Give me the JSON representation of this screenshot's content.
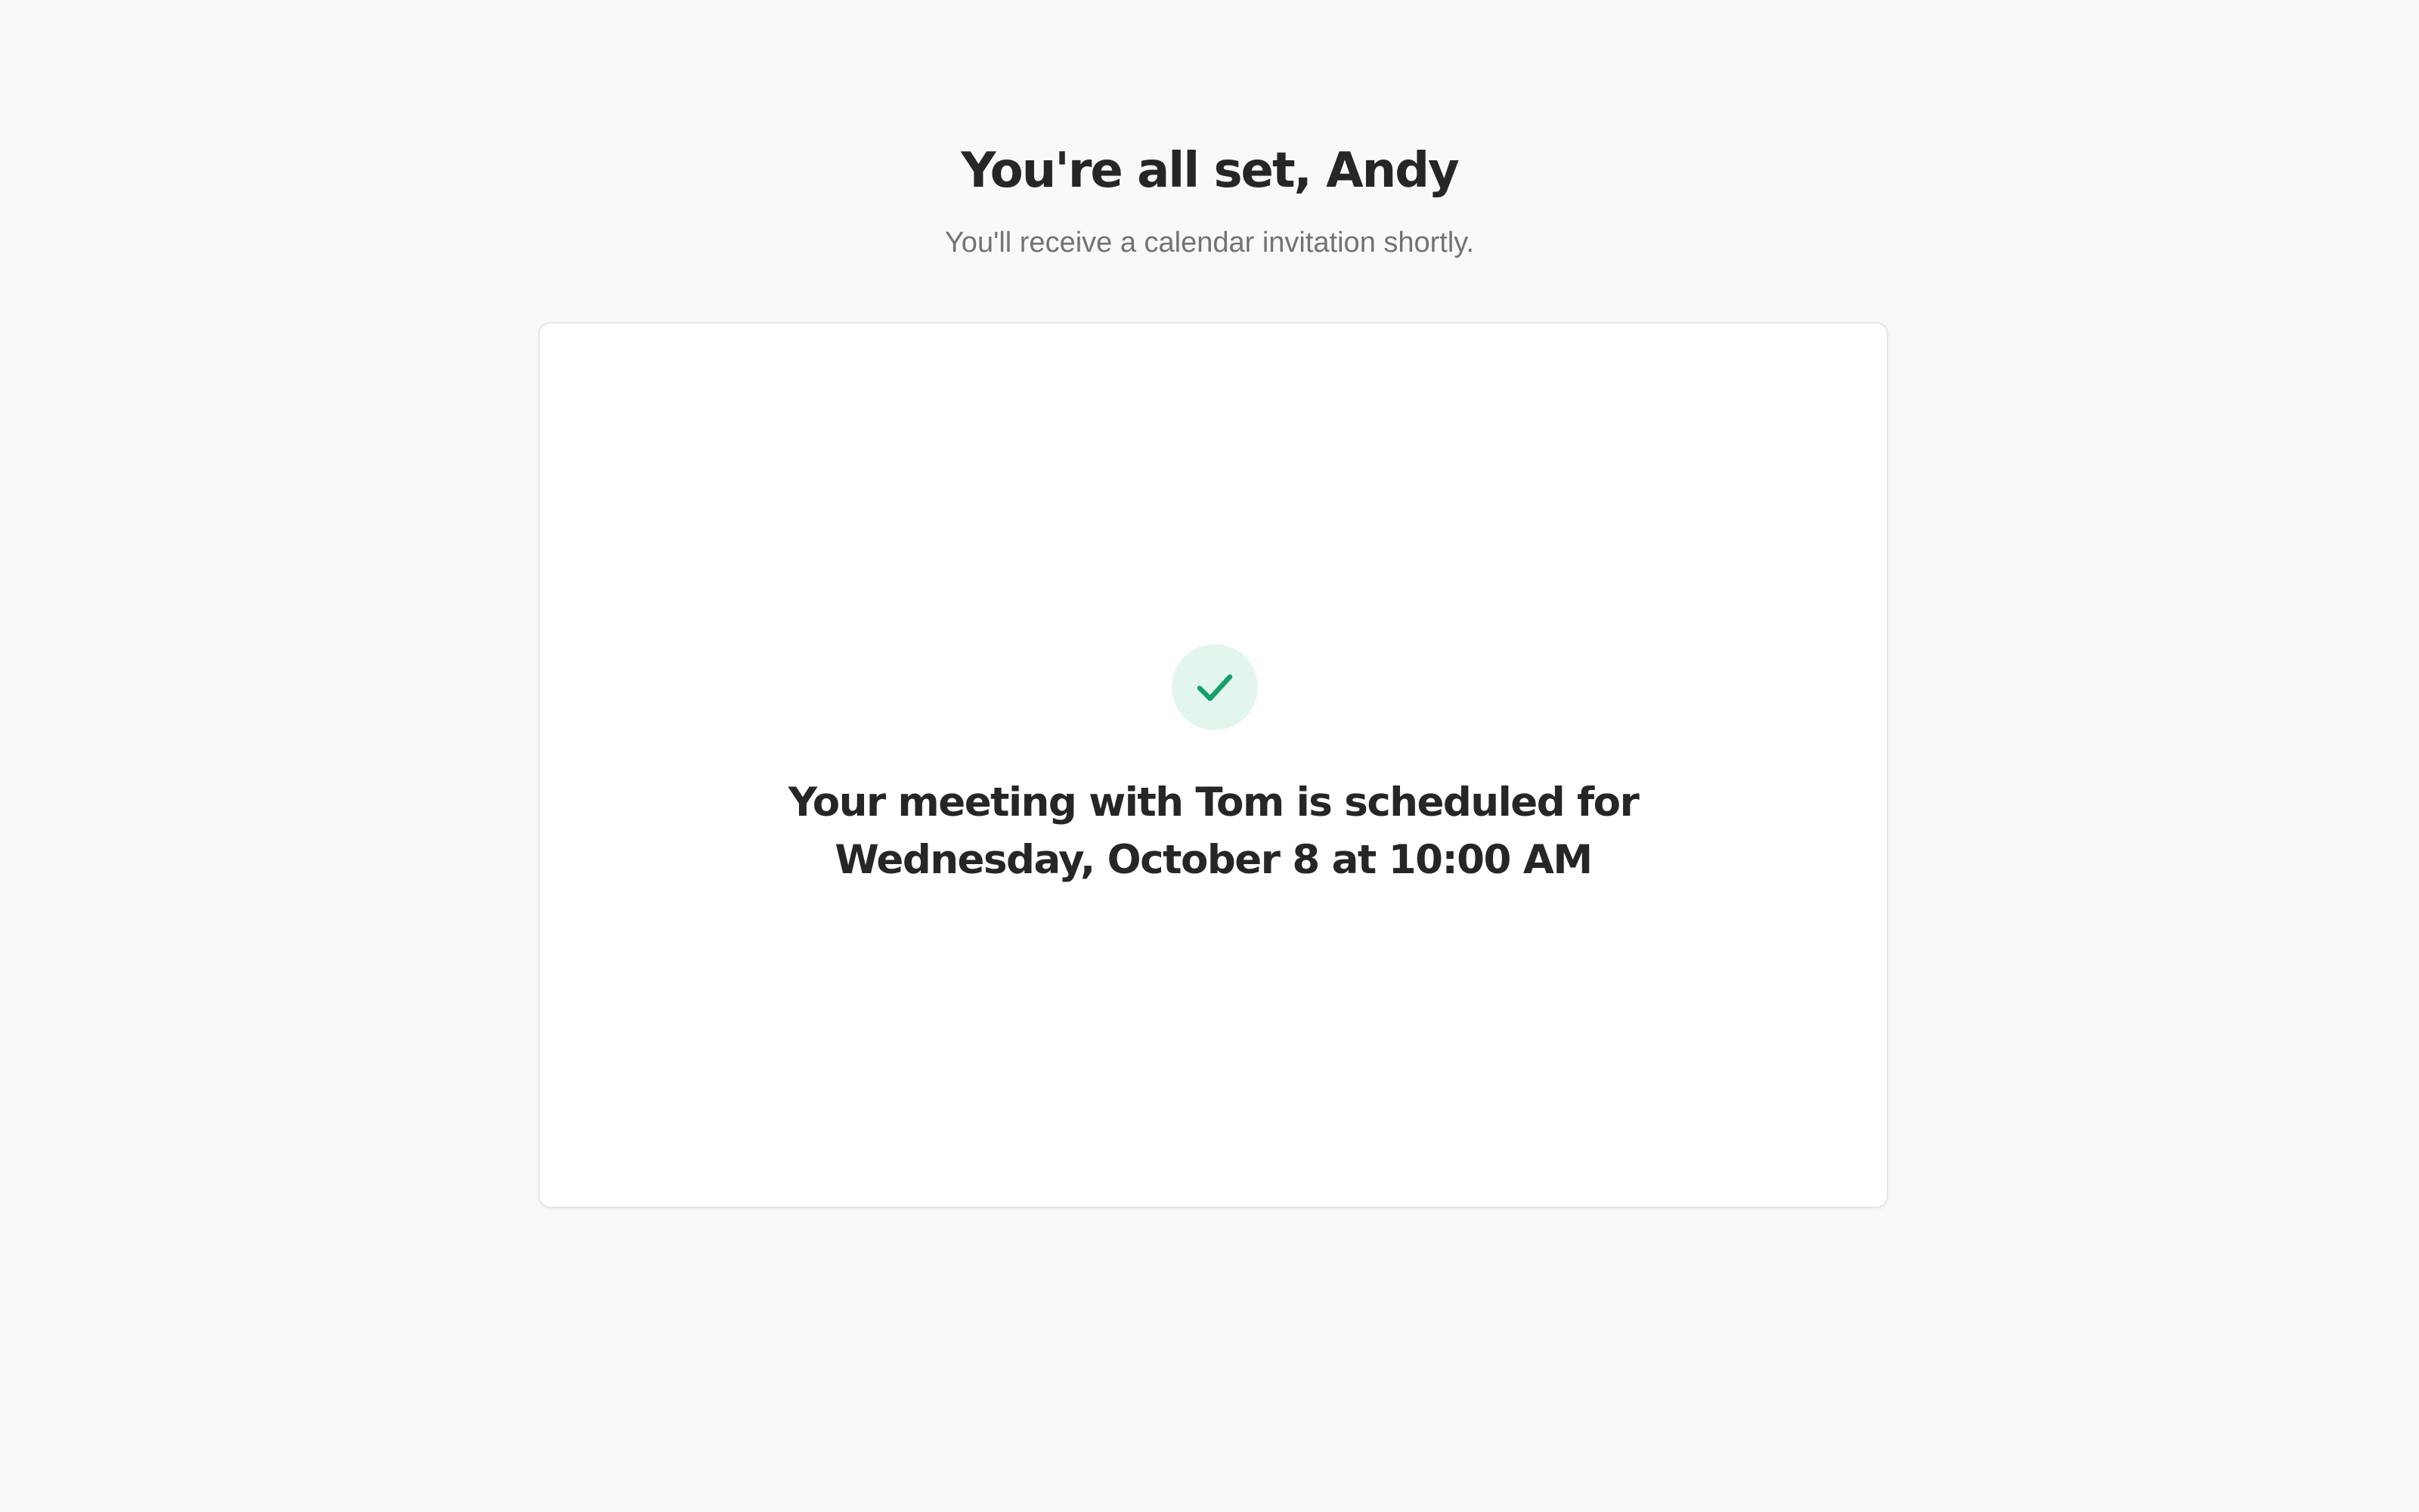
{
  "header": {
    "title": "You're all set, Andy",
    "subtitle": "You'll receive a calendar invitation shortly."
  },
  "confirmation": {
    "icon": "check-icon",
    "message_line1": "Your meeting with Tom is scheduled for",
    "message_line2": "Wednesday, October 8 at 10:00 AM"
  },
  "colors": {
    "page_background": "#f9f9f9",
    "card_background": "#ffffff",
    "card_border": "#e6e6e6",
    "check_badge_background": "#e3f6ee",
    "check_color": "#16a06a",
    "text_primary": "#262626",
    "text_secondary": "#737373"
  }
}
